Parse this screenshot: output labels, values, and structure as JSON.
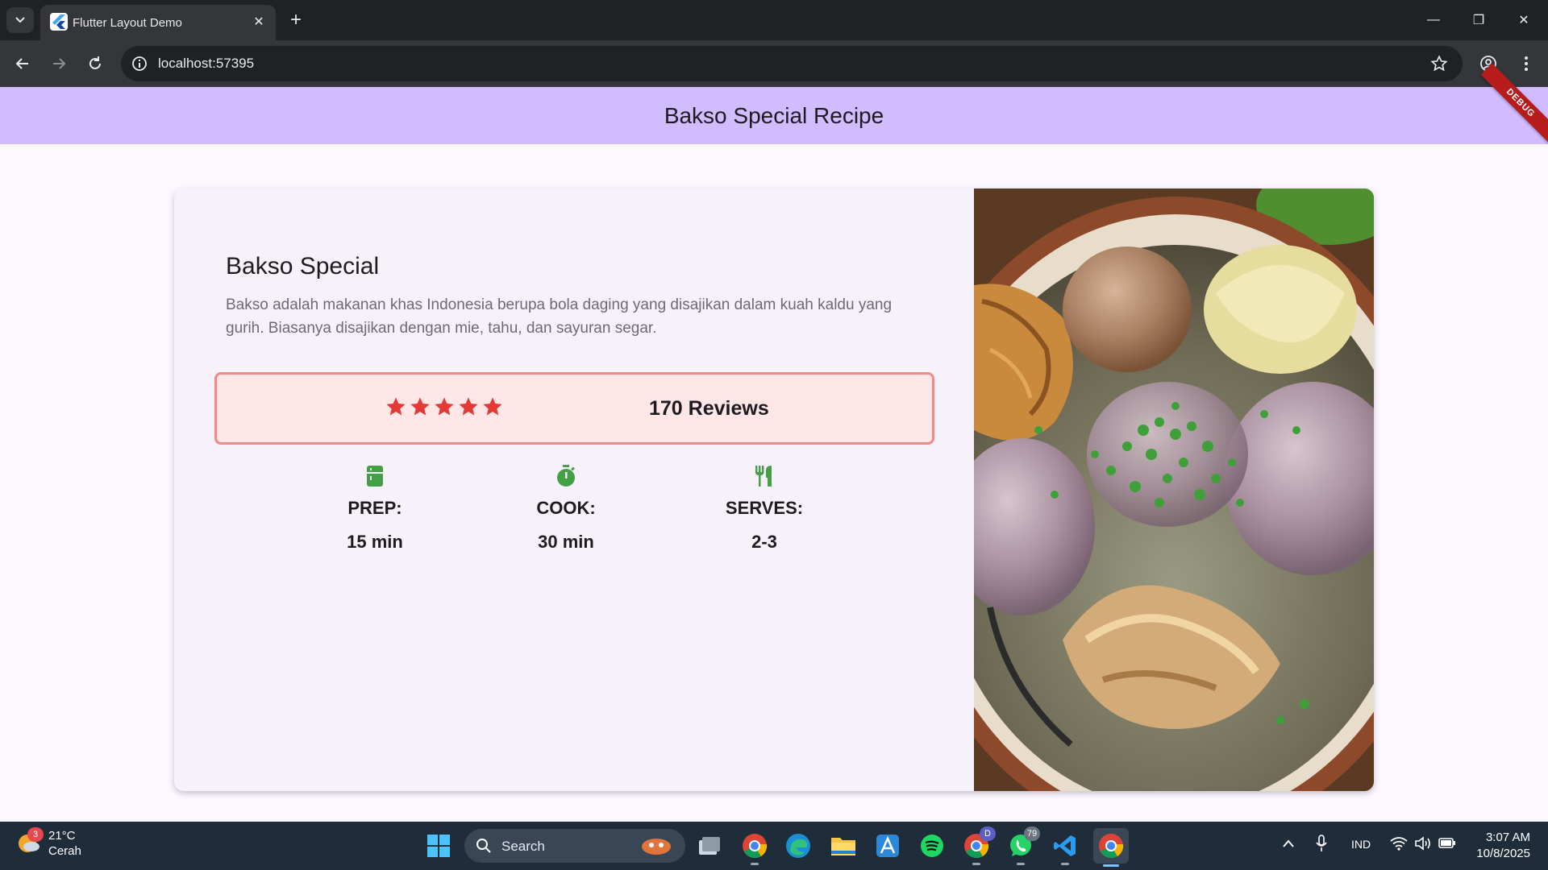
{
  "browser": {
    "tab_title": "Flutter Layout Demo",
    "url": "localhost:57395"
  },
  "app": {
    "title": "Bakso Special Recipe",
    "debug_label": "DEBUG"
  },
  "recipe": {
    "name": "Bakso Special",
    "description": "Bakso adalah makanan khas Indonesia berupa bola daging yang disajikan dalam kuah kaldu yang gurih. Biasanya disajikan dengan mie, tahu, dan sayuran segar.",
    "rating_stars": 5,
    "reviews": "170 Reviews",
    "stats": [
      {
        "icon": "kitchen-icon",
        "label": "PREP:",
        "value": "15 min"
      },
      {
        "icon": "timer-icon",
        "label": "COOK:",
        "value": "30 min"
      },
      {
        "icon": "restaurant-icon",
        "label": "SERVES:",
        "value": "2-3"
      }
    ]
  },
  "colors": {
    "appbar": "#d1bcff",
    "star": "#e53935",
    "stat_icon": "#43a047",
    "rating_border": "#ef8a8a",
    "rating_bg": "#ffe7e7"
  },
  "taskbar": {
    "weather_temp": "21°C",
    "weather_desc": "Cerah",
    "weather_badge": "3",
    "search_label": "Search",
    "whatsapp_badge": "79",
    "chrome_profile_badge": "D",
    "language": "IND",
    "time": "3:07 AM",
    "date": "10/8/2025"
  }
}
